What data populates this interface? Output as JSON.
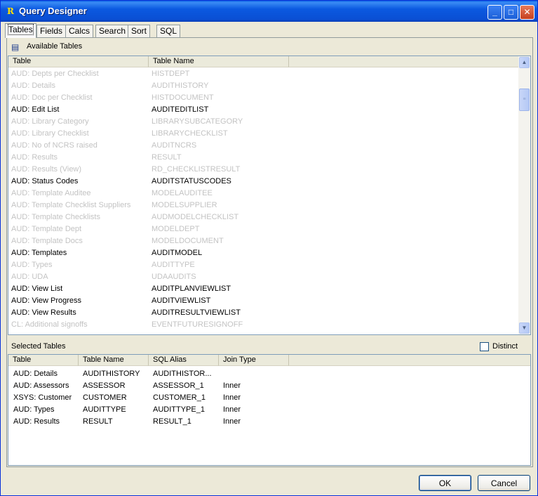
{
  "window": {
    "title": "Query Designer",
    "icon_letter": "R",
    "controls": {
      "minimize": "_",
      "maximize": "□",
      "close": "✕"
    }
  },
  "tabs": [
    "Tables",
    "Fields",
    "Calcs",
    "Search",
    "Sort",
    "SQL"
  ],
  "available": {
    "section_label": "Available Tables",
    "columns": [
      "Table",
      "Table Name"
    ],
    "rows": [
      {
        "table": "AUD: Depts per Checklist",
        "name": "HISTDEPT",
        "enabled": false
      },
      {
        "table": "AUD: Details",
        "name": "AUDITHISTORY",
        "enabled": false
      },
      {
        "table": "AUD: Doc per Checklist",
        "name": "HISTDOCUMENT",
        "enabled": false
      },
      {
        "table": "AUD: Edit List",
        "name": "AUDITEDITLIST",
        "enabled": true
      },
      {
        "table": "AUD: Library Category",
        "name": "LIBRARYSUBCATEGORY",
        "enabled": false
      },
      {
        "table": "AUD: Library Checklist",
        "name": "LIBRARYCHECKLIST",
        "enabled": false
      },
      {
        "table": "AUD: No of NCRS raised",
        "name": "AUDITNCRS",
        "enabled": false
      },
      {
        "table": "AUD: Results",
        "name": "RESULT",
        "enabled": false
      },
      {
        "table": "AUD: Results (View)",
        "name": "RD_CHECKLISTRESULT",
        "enabled": false
      },
      {
        "table": "AUD: Status Codes",
        "name": "AUDITSTATUSCODES",
        "enabled": true
      },
      {
        "table": "AUD: Template Auditee",
        "name": "MODELAUDITEE",
        "enabled": false
      },
      {
        "table": "AUD: Template Checklist Suppliers",
        "name": "MODELSUPPLIER",
        "enabled": false
      },
      {
        "table": "AUD: Template Checklists",
        "name": "AUDMODELCHECKLIST",
        "enabled": false
      },
      {
        "table": "AUD: Template Dept",
        "name": "MODELDEPT",
        "enabled": false
      },
      {
        "table": "AUD: Template Docs",
        "name": "MODELDOCUMENT",
        "enabled": false
      },
      {
        "table": "AUD: Templates",
        "name": "AUDITMODEL",
        "enabled": true
      },
      {
        "table": "AUD: Types",
        "name": "AUDITTYPE",
        "enabled": false
      },
      {
        "table": "AUD: UDA",
        "name": "UDAAUDITS",
        "enabled": false
      },
      {
        "table": "AUD: View List",
        "name": "AUDITPLANVIEWLIST",
        "enabled": true
      },
      {
        "table": "AUD: View Progress",
        "name": "AUDITVIEWLIST",
        "enabled": true
      },
      {
        "table": "AUD: View Results",
        "name": "AUDITRESULTVIEWLIST",
        "enabled": true
      },
      {
        "table": "CL: Additional signoffs",
        "name": "EVENTFUTURESIGNOFF",
        "enabled": false
      }
    ]
  },
  "selected": {
    "section_label": "Selected Tables",
    "distinct_label": "Distinct",
    "distinct_checked": false,
    "columns": [
      "Table",
      "Table Name",
      "SQL Alias",
      "Join Type"
    ],
    "rows": [
      {
        "table": "AUD: Details",
        "name": "AUDITHISTORY",
        "alias": "AUDITHISTOR...",
        "join": ""
      },
      {
        "table": "AUD: Assessors",
        "name": "ASSESSOR",
        "alias": "ASSESSOR_1",
        "join": "Inner"
      },
      {
        "table": "XSYS: Customer",
        "name": "CUSTOMER",
        "alias": "CUSTOMER_1",
        "join": "Inner"
      },
      {
        "table": "AUD: Types",
        "name": "AUDITTYPE",
        "alias": "AUDITTYPE_1",
        "join": "Inner"
      },
      {
        "table": "AUD: Results",
        "name": "RESULT",
        "alias": "RESULT_1",
        "join": "Inner"
      }
    ]
  },
  "buttons": {
    "ok": "OK",
    "cancel": "Cancel"
  },
  "colors": {
    "titlebar": "#0a5fe4",
    "disabled_text": "#c3c3c3",
    "face": "#ece9d8"
  }
}
